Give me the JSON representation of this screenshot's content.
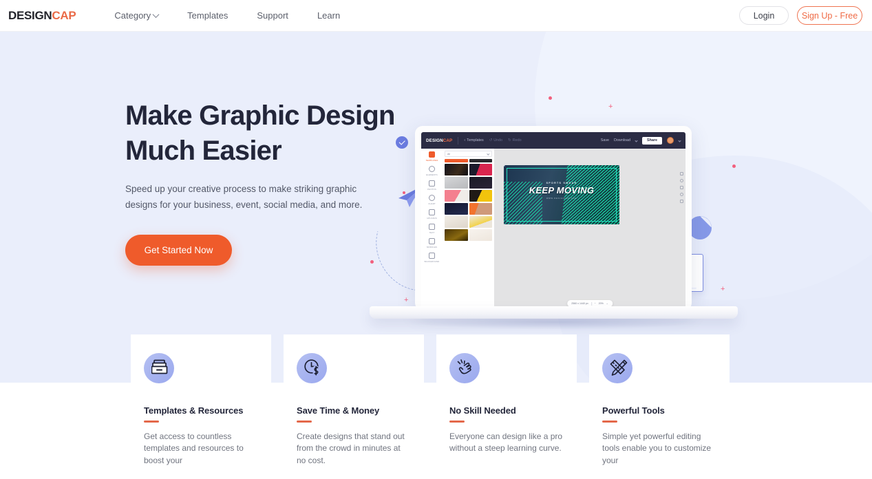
{
  "brand": {
    "part1": "DESIGN",
    "part2": "CAP"
  },
  "nav": {
    "items": [
      {
        "label": "Category",
        "has_caret": true
      },
      {
        "label": "Templates",
        "has_caret": false
      },
      {
        "label": "Support",
        "has_caret": false
      },
      {
        "label": "Learn",
        "has_caret": false
      }
    ],
    "login_label": "Login",
    "signup_label": "Sign Up - Free"
  },
  "hero": {
    "title_line1": "Make Graphic Design",
    "title_line2": "Much Easier",
    "subtitle": "Speed up your creative process to make striking graphic designs for your business, event, social media, and more.",
    "cta_label": "Get Started Now",
    "bg_color": "#eaeefb",
    "accent_color": "#ef5b2b"
  },
  "mockup": {
    "logo_part1": "DESIGN",
    "logo_part2": "CAP",
    "back_label": "Templates",
    "undo_label": "Undo",
    "redo_label": "Redo",
    "save_label": "Save",
    "download_label": "Download",
    "share_label": "Share",
    "rail": [
      {
        "label": "TEMPLATES",
        "active": true
      },
      {
        "label": "ELEMENTS",
        "active": false
      },
      {
        "label": "PHOTOS",
        "active": false
      },
      {
        "label": "CHART",
        "active": false
      },
      {
        "label": "UPLOADS",
        "active": false
      },
      {
        "label": "TEXT",
        "active": false
      },
      {
        "label": "MODULES",
        "active": false
      },
      {
        "label": "BACKGROUND",
        "active": false
      }
    ],
    "filter_value": "All",
    "thumbnails": [
      {
        "bg": "#ef5b2b"
      },
      {
        "bg": "#2a2a2e"
      },
      {
        "bg": "#181a22"
      },
      {
        "bg": "#d9254e"
      },
      {
        "bg": "#cfd0d2"
      },
      {
        "bg": "#1b1b27"
      },
      {
        "bg": "#ef6a7e"
      },
      {
        "bg": "#f0b429"
      },
      {
        "bg": "#171a2c"
      },
      {
        "bg": "#f2732e"
      },
      {
        "bg": "#ece7e1"
      },
      {
        "bg": "#e8e2d6"
      },
      {
        "bg": "#4a3405"
      },
      {
        "bg": "#f3eee6"
      }
    ],
    "design": {
      "kicker": "SPORTS SWEAR",
      "headline": "KEEP MOVING",
      "url": "WWW.DESIGNCAP.COM"
    },
    "zoom_size": "2560 x 1440 px",
    "zoom_level": "20%"
  },
  "features": [
    {
      "icon": "archive-box-icon",
      "title": "Templates & Resources",
      "desc": "Get access to countless templates and resources to boost your"
    },
    {
      "icon": "clock-dollar-icon",
      "title": "Save Time & Money",
      "desc": "Create designs that stand out from the crowd in minutes at no cost."
    },
    {
      "icon": "snap-fingers-icon",
      "title": "No Skill Needed",
      "desc": "Everyone can design like a pro without a steep learning curve."
    },
    {
      "icon": "pencil-ruler-icon",
      "title": "Powerful Tools",
      "desc": "Simple yet powerful editing tools enable you to customize your"
    }
  ]
}
